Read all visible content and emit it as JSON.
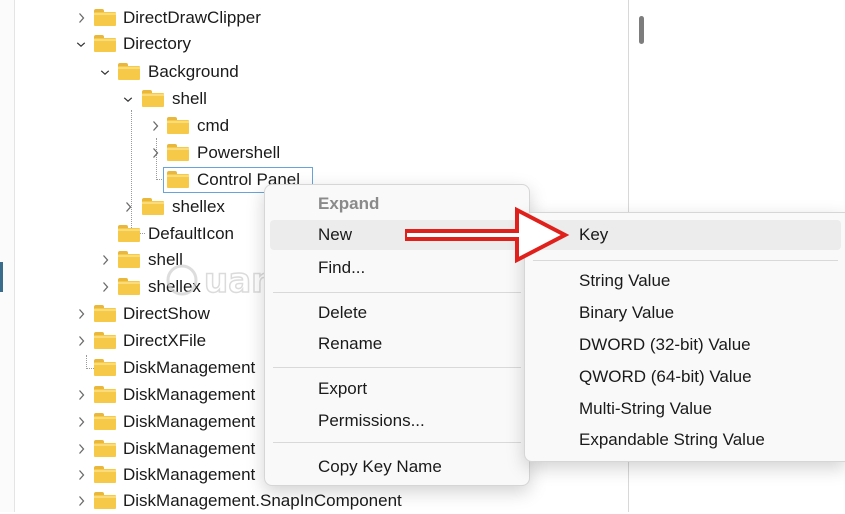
{
  "tree": {
    "items": [
      {
        "label": "DirectDrawClipper",
        "expanded": false
      },
      {
        "label": "Directory",
        "expanded": true
      },
      {
        "label": "Background",
        "expanded": true
      },
      {
        "label": "shell",
        "expanded": true
      },
      {
        "label": "cmd",
        "expanded": false
      },
      {
        "label": "Powershell",
        "expanded": false
      },
      {
        "label": "Control Panel",
        "selected": true
      },
      {
        "label": "shellex",
        "expanded": false
      },
      {
        "label": "DefaultIcon"
      },
      {
        "label": "shell",
        "expanded": false
      },
      {
        "label": "shellex",
        "expanded": false
      },
      {
        "label": "DirectShow",
        "expanded": false
      },
      {
        "label": "DirectXFile",
        "expanded": false
      },
      {
        "label": "DiskManagement"
      },
      {
        "label": "DiskManagement",
        "expanded": false
      },
      {
        "label": "DiskManagement",
        "expanded": false
      },
      {
        "label": "DiskManagement",
        "expanded": false
      },
      {
        "label": "DiskManagement",
        "expanded": false
      },
      {
        "label": "DiskManagement.SnapInComponent",
        "expanded": false
      }
    ]
  },
  "context_menu": {
    "expand": "Expand",
    "new": "New",
    "find": "Find...",
    "delete": "Delete",
    "rename": "Rename",
    "export": "Export",
    "permissions": "Permissions...",
    "copy_key_name": "Copy Key Name"
  },
  "submenu": {
    "key": "Key",
    "string_value": "String Value",
    "binary_value": "Binary Value",
    "dword": "DWORD (32-bit) Value",
    "qword": "QWORD (64-bit) Value",
    "multi_string": "Multi-String Value",
    "expandable_string": "Expandable String Value"
  },
  "annotation": {
    "arrow_color": "#e0201b"
  },
  "icons": {
    "folder": "folder-icon",
    "chevron_right": "chevron-right-icon",
    "chevron_down": "chevron-down-icon",
    "submenu_arrow": "submenu-arrow-icon",
    "annotation_arrow": "red-arrow-icon"
  },
  "colors": {
    "folder": "#f7c948",
    "selection_border": "#6aa3d8",
    "menu_bg": "#f9f9f9",
    "hover": "#ececec"
  }
}
